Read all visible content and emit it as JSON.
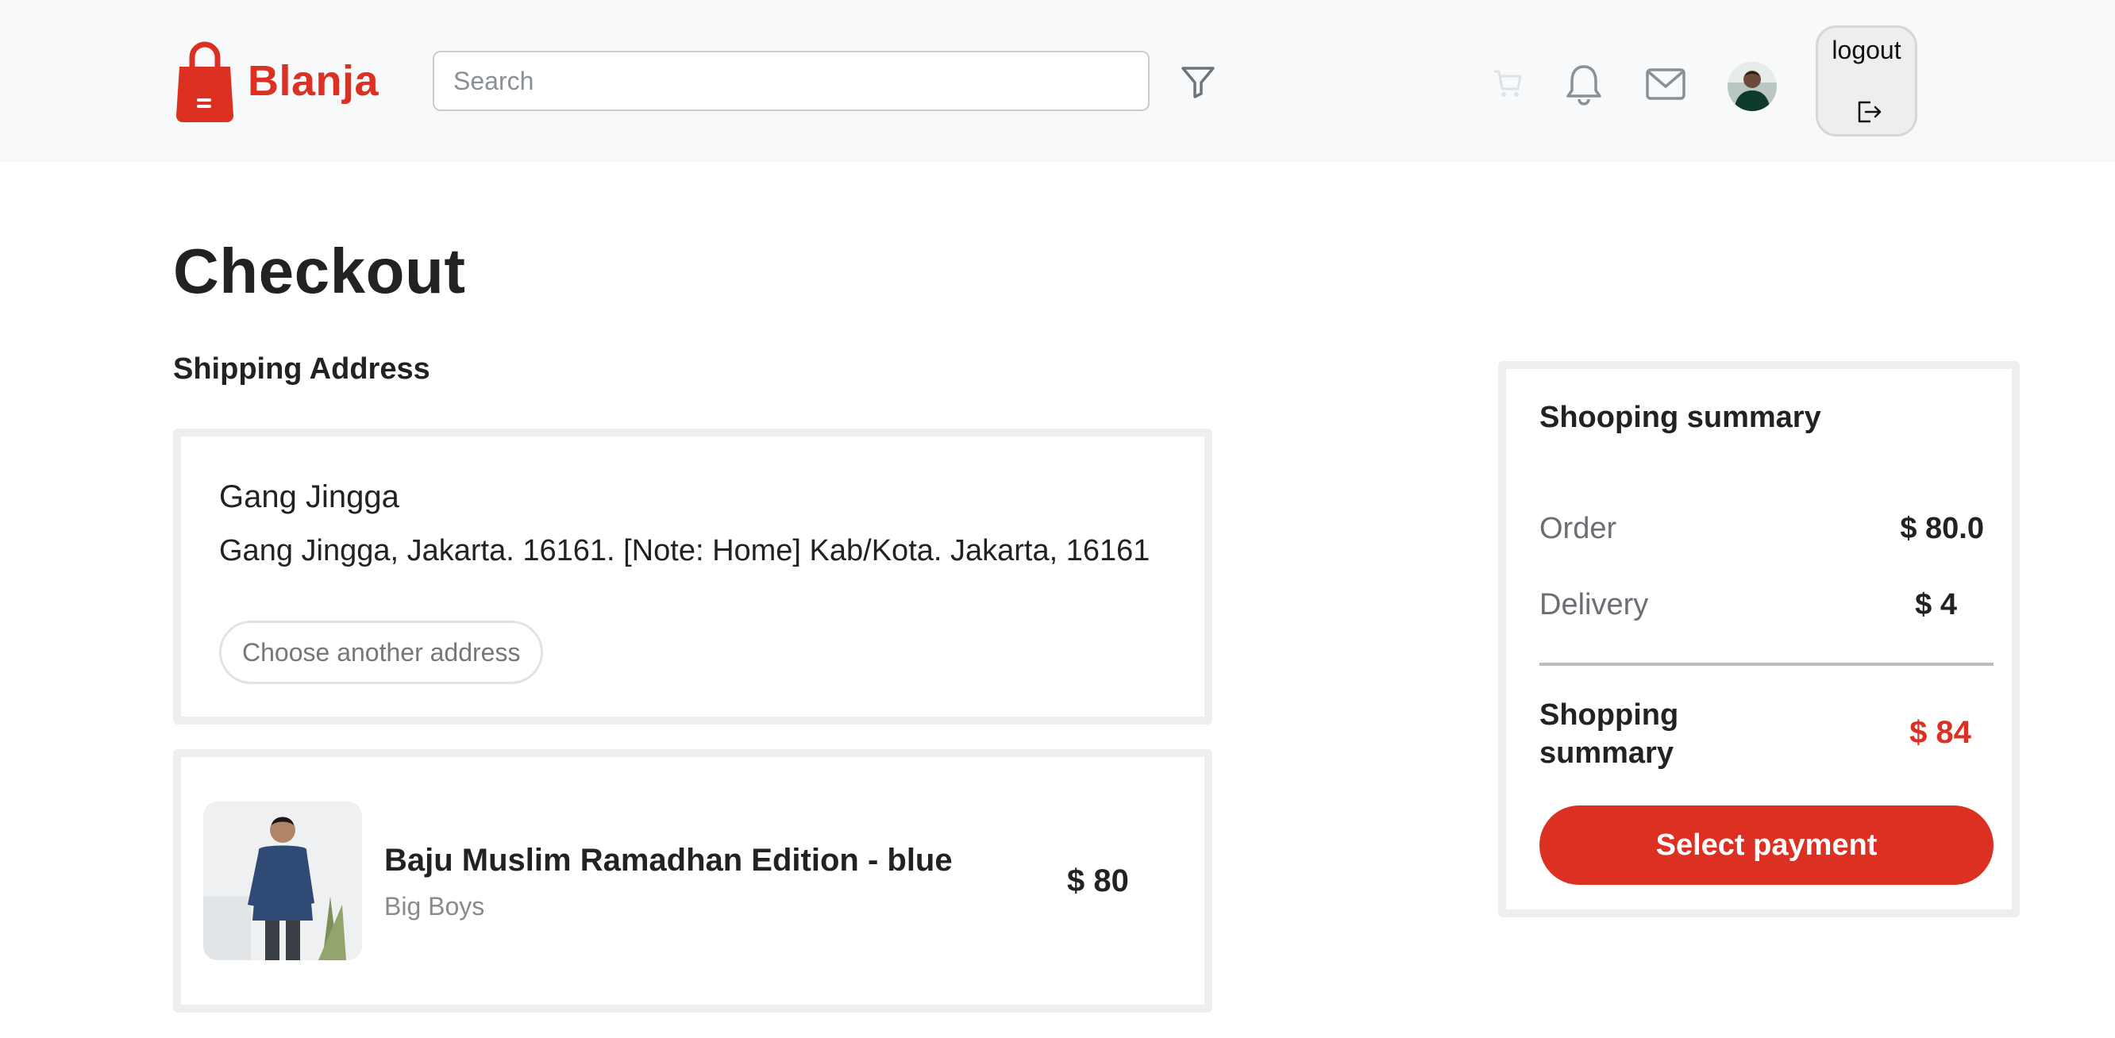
{
  "colors": {
    "brand": "#db3022",
    "nav_bg": "#f8f9fa",
    "card_border": "#eeeeee",
    "muted_text": "#6b6f75"
  },
  "header": {
    "brand_name": "Blanja",
    "brand_icon": "shopping-bag-icon",
    "search": {
      "placeholder": "Search",
      "value": ""
    },
    "icons": [
      "filter-icon",
      "cart-icon",
      "bell-icon",
      "mail-icon"
    ],
    "logout_label": "logout",
    "logout_icon": "logout-icon"
  },
  "page": {
    "title": "Checkout",
    "shipping_title": "Shipping Address"
  },
  "address": {
    "name": "Gang Jingga",
    "detail": "Gang Jingga, Jakarta. 16161. [Note: Home] Kab/Kota. Jakarta, 16161",
    "change_label": "Choose another address"
  },
  "product": {
    "name": "Baju Muslim Ramadhan Edition - blue",
    "brand": "Big Boys",
    "price": "$ 80"
  },
  "summary": {
    "title": "Shooping summary",
    "order_label": "Order",
    "order_value": "$ 80.0",
    "delivery_label": "Delivery",
    "delivery_value": "$ 4",
    "total_label": "Shopping summary",
    "total_value": "$ 84",
    "pay_label": "Select payment"
  }
}
